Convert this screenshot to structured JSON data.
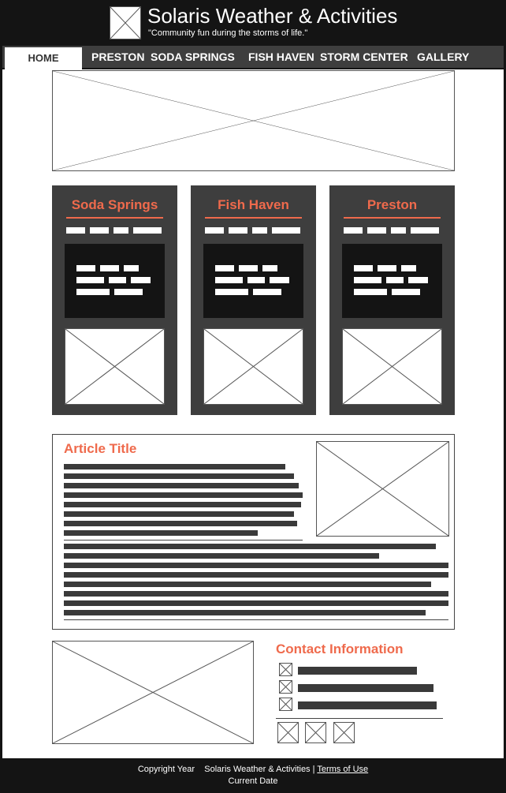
{
  "header": {
    "title": "Solaris Weather & Activities",
    "tagline": "\"Community fun during the storms of life.\""
  },
  "nav": {
    "items": [
      "HOME",
      "PRESTON",
      "SODA SPRINGS",
      "FISH HAVEN",
      "STORM CENTER",
      "GALLERY"
    ],
    "active": "HOME"
  },
  "cards": [
    {
      "title": "Soda Springs"
    },
    {
      "title": "Fish Haven"
    },
    {
      "title": "Preston"
    }
  ],
  "article": {
    "title": "Article Title"
  },
  "contact": {
    "title": "Contact Information"
  },
  "footer": {
    "copyright": "Copyright Year",
    "site": "Solaris Weather & Activities",
    "separator": "|",
    "terms": "Terms of Use",
    "date": "Current Date"
  },
  "colors": {
    "dark": "#141414",
    "panel": "#3e3e3e",
    "accent": "#ef6a4c"
  }
}
